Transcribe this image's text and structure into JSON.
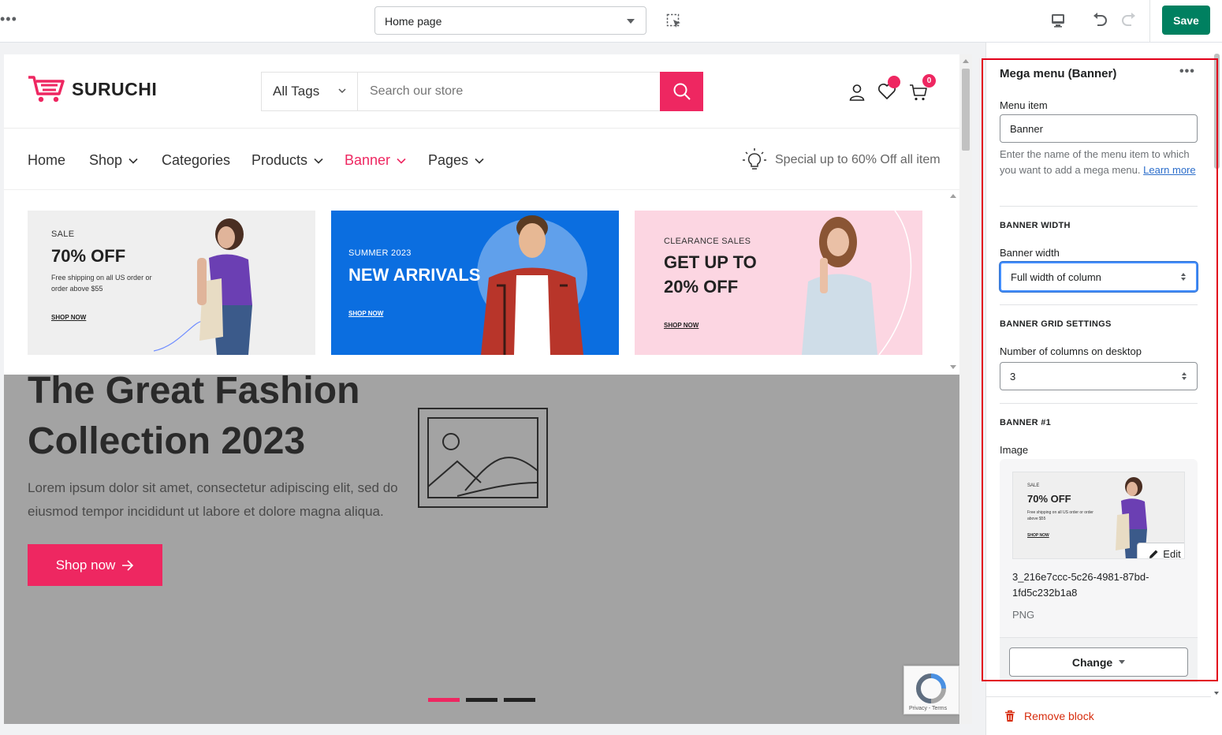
{
  "topbar": {
    "more_label": "•••",
    "page_select": "Home page",
    "save_label": "Save"
  },
  "store": {
    "logo": "SURUCHI",
    "tag_select": "All Tags",
    "search_placeholder": "Search our store",
    "cart_count": "0",
    "nav": [
      "Home",
      "Shop",
      "Categories",
      "Products",
      "Banner",
      "Pages"
    ],
    "promo": "Special up to 60% Off all item",
    "banners": [
      {
        "sub": "SALE",
        "title": "70% OFF",
        "desc": "Free shipping on all US order or order above $55",
        "link": "SHOP NOW"
      },
      {
        "sub": "SUMMER 2023",
        "title": "NEW ARRIVALS",
        "link": "SHOP NOW"
      },
      {
        "sub": "CLEARANCE SALES",
        "title": "GET UP TO 20% OFF",
        "link": "SHOP NOW"
      }
    ],
    "hero": {
      "title": "The Great Fashion Collection 2023",
      "text": "Lorem ipsum dolor sit amet, consectetur adipiscing elit, sed do eiusmod tempor incididunt ut labore et dolore magna aliqua.",
      "button": "Shop now"
    },
    "recaptcha": "Privacy - Terms"
  },
  "sidebar": {
    "title": "Mega menu (Banner)",
    "more_label": "•••",
    "menu_item_label": "Menu item",
    "menu_item_value": "Banner",
    "menu_item_help": "Enter the name of the menu item to which you want to add a mega menu.",
    "learn_more": "Learn more",
    "banner_width_heading": "BANNER WIDTH",
    "banner_width_label": "Banner width",
    "banner_width_value": "Full width of column",
    "grid_heading": "BANNER GRID SETTINGS",
    "columns_label": "Number of columns on desktop",
    "columns_value": "3",
    "banner1_heading": "BANNER #1",
    "image_label": "Image",
    "thumb_sub": "SALE",
    "thumb_title": "70% OFF",
    "thumb_desc": "Free shipping on all US order or order above $55",
    "thumb_link": "SHOP NOW",
    "edit_label": "Edit",
    "file_name": "3_216e7ccc-5c26-4981-87bd-1fd5c232b1a8",
    "file_type": "PNG",
    "change_label": "Change",
    "remove_label": "Remove block"
  },
  "colors": {
    "brand": "#ee2761",
    "save": "#008060",
    "highlight_frame": "#e2001a"
  }
}
